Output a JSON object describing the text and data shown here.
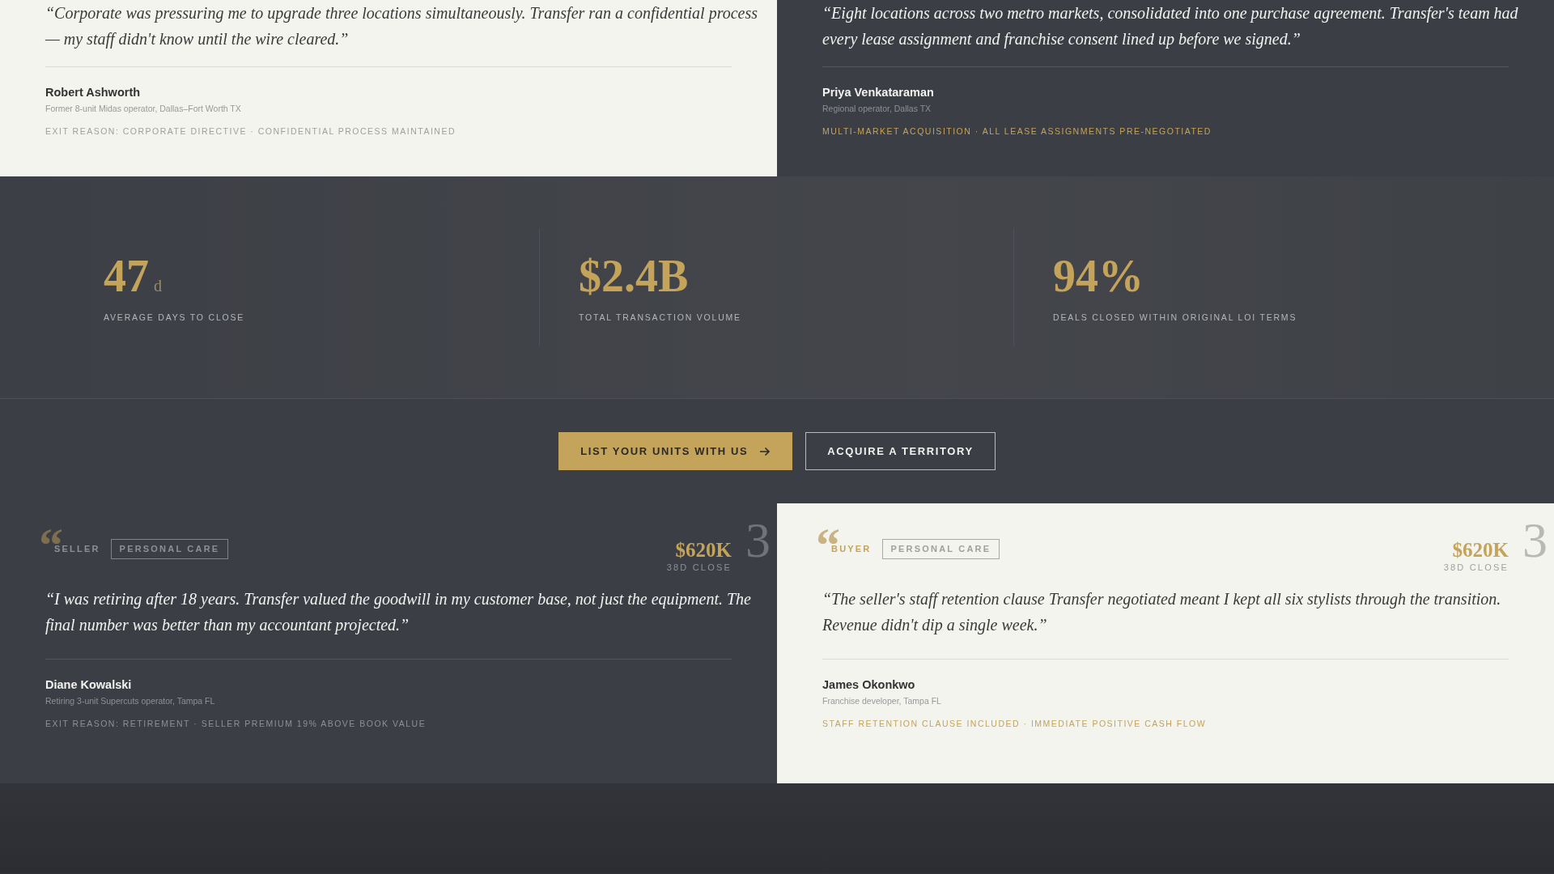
{
  "top_testimonials": [
    {
      "dark": false,
      "kind": "seller",
      "quote": "“Corporate was pressuring me to upgrade three locations simultaneously. Transfer ran a confidential process — my staff didn't know until the wire cleared.”",
      "name": "Robert Ashworth",
      "role": "Former 8-unit Midas operator, Dallas–Fort Worth TX",
      "tags": "EXIT REASON: CORPORATE DIRECTIVE · CONFIDENTIAL PROCESS MAINTAINED"
    },
    {
      "dark": true,
      "kind": "buyer",
      "quote": "“Eight locations across two metro markets, consolidated into one purchase agreement. Transfer's team had every lease assignment and franchise consent lined up before we signed.”",
      "name": "Priya Venkataraman",
      "role": "Regional operator, Dallas TX",
      "tags": "MULTI-MARKET ACQUISITION · ALL LEASE ASSIGNMENTS PRE-NEGOTIATED"
    }
  ],
  "stats": [
    {
      "value": "47",
      "unit": "d",
      "label": "AVERAGE DAYS TO CLOSE"
    },
    {
      "value": "$2.4B",
      "label": "TOTAL TRANSACTION VOLUME"
    },
    {
      "value": "94%",
      "label": "DEALS CLOSED WITHIN ORIGINAL LOI TERMS"
    }
  ],
  "actions": [
    {
      "kind": "primary",
      "label": "LIST YOUR UNITS WITH US"
    },
    {
      "kind": "secondary",
      "label": "ACQUIRE A TERRITORY"
    }
  ],
  "testimonials": [
    {
      "dark": true,
      "kind": "seller",
      "quote_mark": "“",
      "role_label": "SELLER",
      "category": "PERSONAL CARE",
      "amount": "$620K",
      "close": "38D CLOSE",
      "number": "3",
      "quote": "“I was retiring after 18 years. Transfer valued the goodwill in my customer base, not just the equipment. The final number was better than my accountant projected.”",
      "name": "Diane Kowalski",
      "role": "Retiring 3-unit Supercuts operator, Tampa FL",
      "tags": "EXIT REASON: RETIREMENT · SELLER PREMIUM 19% ABOVE BOOK VALUE"
    },
    {
      "dark": false,
      "kind": "buyer",
      "quote_mark": "“",
      "role_label": "BUYER",
      "category": "PERSONAL CARE",
      "amount": "$620K",
      "close": "38D CLOSE",
      "number": "3",
      "quote": "“The seller's staff retention clause Transfer negotiated meant I kept all six stylists through the transition. Revenue didn't dip a single week.”",
      "name": "James Okonkwo",
      "role": "Franchise developer, Tampa FL",
      "tags": "STAFF RETENTION CLAUSE INCLUDED · IMMEDIATE POSITIVE CASH FLOW"
    }
  ]
}
